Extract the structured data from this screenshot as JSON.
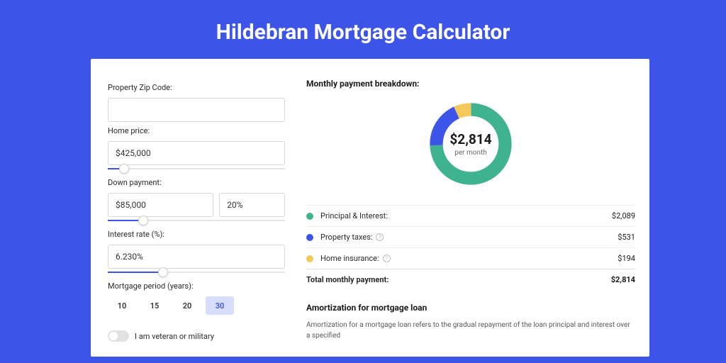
{
  "title": "Hildebran Mortgage Calculator",
  "form": {
    "zip_label": "Property Zip Code:",
    "zip_value": "",
    "price_label": "Home price:",
    "price_value": "$425,000",
    "price_slider_pct": 9,
    "down_label": "Down payment:",
    "down_value": "$85,000",
    "down_pct_value": "20%",
    "down_slider_pct": 20,
    "rate_label": "Interest rate (%):",
    "rate_value": "6.230%",
    "rate_slider_pct": 31,
    "period_label": "Mortgage period (years):",
    "periods": [
      "10",
      "15",
      "20",
      "30"
    ],
    "period_active_index": 3,
    "veteran_label": "I am veteran or military"
  },
  "breakdown": {
    "heading": "Monthly payment breakdown:",
    "center_amount": "$2,814",
    "center_sub": "per month",
    "rows": [
      {
        "color": "#3fb28f",
        "label": "Principal & Interest:",
        "value": "$2,089",
        "info": false
      },
      {
        "color": "#3c55e8",
        "label": "Property taxes:",
        "value": "$531",
        "info": true
      },
      {
        "color": "#f3c95c",
        "label": "Home insurance:",
        "value": "$194",
        "info": true
      }
    ],
    "total_label": "Total monthly payment:",
    "total_value": "$2,814"
  },
  "amort": {
    "heading": "Amortization for mortgage loan",
    "text": "Amortization for a mortgage loan refers to the gradual repayment of the loan principal and interest over a specified"
  },
  "chart_data": {
    "type": "pie",
    "title": "Monthly payment breakdown",
    "series": [
      {
        "name": "Principal & Interest",
        "value": 2089,
        "color": "#3fb28f"
      },
      {
        "name": "Property taxes",
        "value": 531,
        "color": "#3c55e8"
      },
      {
        "name": "Home insurance",
        "value": 194,
        "color": "#f3c95c"
      }
    ],
    "total": 2814,
    "unit": "USD per month"
  }
}
